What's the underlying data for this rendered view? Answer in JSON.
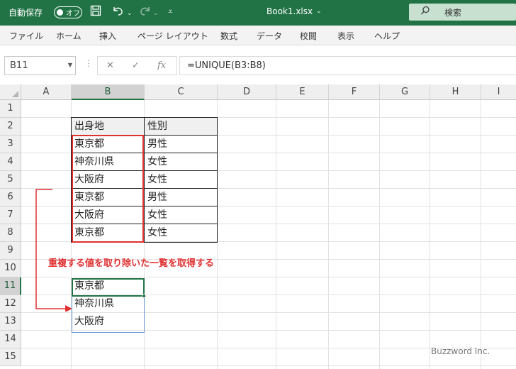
{
  "titlebar": {
    "autosave_label": "自動保存",
    "autosave_toggle_state": "オフ",
    "file_name": "Book1.xlsx",
    "file_dropdown": "⌄",
    "search_placeholder": "検索",
    "icons": [
      "save-icon",
      "undo-icon",
      "redo-icon",
      "customize-quick-access-icon",
      "search-icon"
    ]
  },
  "menu": {
    "items": [
      "ファイル",
      "ホーム",
      "挿入",
      "ページ レイアウト",
      "数式",
      "データ",
      "校閲",
      "表示",
      "ヘルプ"
    ]
  },
  "formula_bar": {
    "name_box": "B11",
    "formula": "=UNIQUE(B3:B8)",
    "fx_label": "fx"
  },
  "sheet": {
    "columns": [
      "A",
      "B",
      "C",
      "D",
      "E",
      "F",
      "G",
      "H",
      "I"
    ],
    "rows": [
      "1",
      "2",
      "3",
      "4",
      "5",
      "6",
      "7",
      "8",
      "9",
      "10",
      "11",
      "12",
      "13",
      "14",
      "15"
    ],
    "selected_column": "B",
    "selected_row": "11",
    "table": {
      "headers": [
        "出身地",
        "性別"
      ],
      "rows": [
        [
          "東京都",
          "男性"
        ],
        [
          "神奈川県",
          "女性"
        ],
        [
          "大阪府",
          "女性"
        ],
        [
          "東京都",
          "男性"
        ],
        [
          "大阪府",
          "女性"
        ],
        [
          "東京都",
          "女性"
        ]
      ]
    },
    "spill_result": [
      "東京都",
      "神奈川県",
      "大阪府"
    ],
    "annotation": "重複する値を取り除いた一覧を取得する",
    "highlight_color": "#e03131",
    "accent_color": "#217346"
  },
  "watermark": "Buzzword Inc."
}
